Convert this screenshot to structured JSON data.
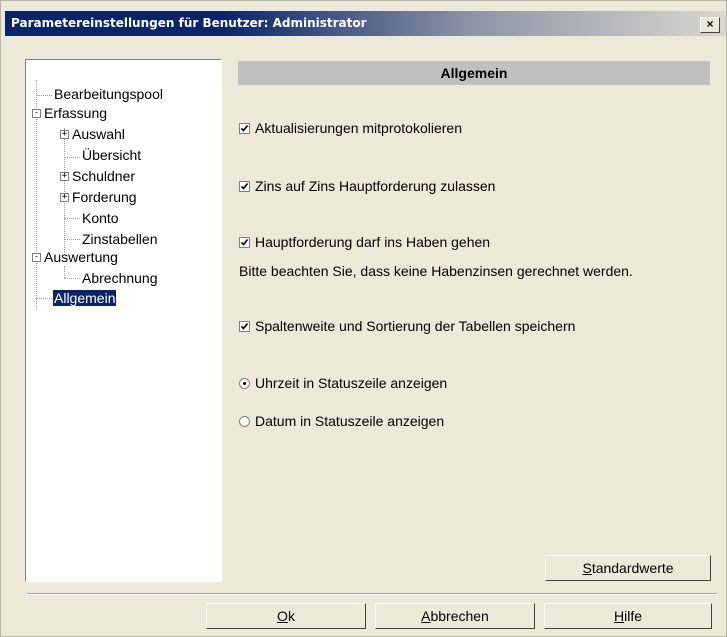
{
  "window": {
    "title": "Parametereinstellungen für Benutzer: Administrator",
    "close_label": "×"
  },
  "tree": {
    "items": [
      {
        "label": "Bearbeitungspool"
      },
      {
        "label": "Erfassung",
        "expander": "-"
      },
      {
        "label": "Auswahl",
        "expander": "+"
      },
      {
        "label": "Übersicht"
      },
      {
        "label": "Schuldner",
        "expander": "+"
      },
      {
        "label": "Forderung",
        "expander": "+"
      },
      {
        "label": "Konto"
      },
      {
        "label": "Zinstabellen"
      },
      {
        "label": "Auswertung",
        "expander": "-"
      },
      {
        "label": "Abrechnung"
      },
      {
        "label": "Allgemein",
        "selected": true
      }
    ]
  },
  "panel": {
    "header": "Allgemein",
    "options": [
      {
        "type": "checkbox",
        "label": "Aktualisierungen mitprotokolieren",
        "checked": true
      },
      {
        "type": "checkbox",
        "label": "Zins auf Zins Hauptforderung zulassen",
        "checked": true
      },
      {
        "type": "checkbox",
        "label": "Hauptforderung darf ins Haben gehen",
        "checked": true
      },
      {
        "type": "checkbox",
        "label": "Spaltenweite und Sortierung der Tabellen speichern",
        "checked": true
      },
      {
        "type": "radio",
        "label": "Uhrzeit in Statuszeile anzeigen",
        "checked": true
      },
      {
        "type": "radio",
        "label": "Datum in Statuszeile anzeigen",
        "checked": false
      }
    ],
    "note": "Bitte beachten Sie, dass keine Habenzinsen gerechnet werden."
  },
  "buttons": {
    "defaults": {
      "underline": "S",
      "rest": "tandardwerte"
    },
    "ok": {
      "underline": "O",
      "rest": "k"
    },
    "cancel": {
      "underline": "A",
      "rest": "bbrechen"
    },
    "help": {
      "underline": "H",
      "rest": "ilfe"
    }
  }
}
